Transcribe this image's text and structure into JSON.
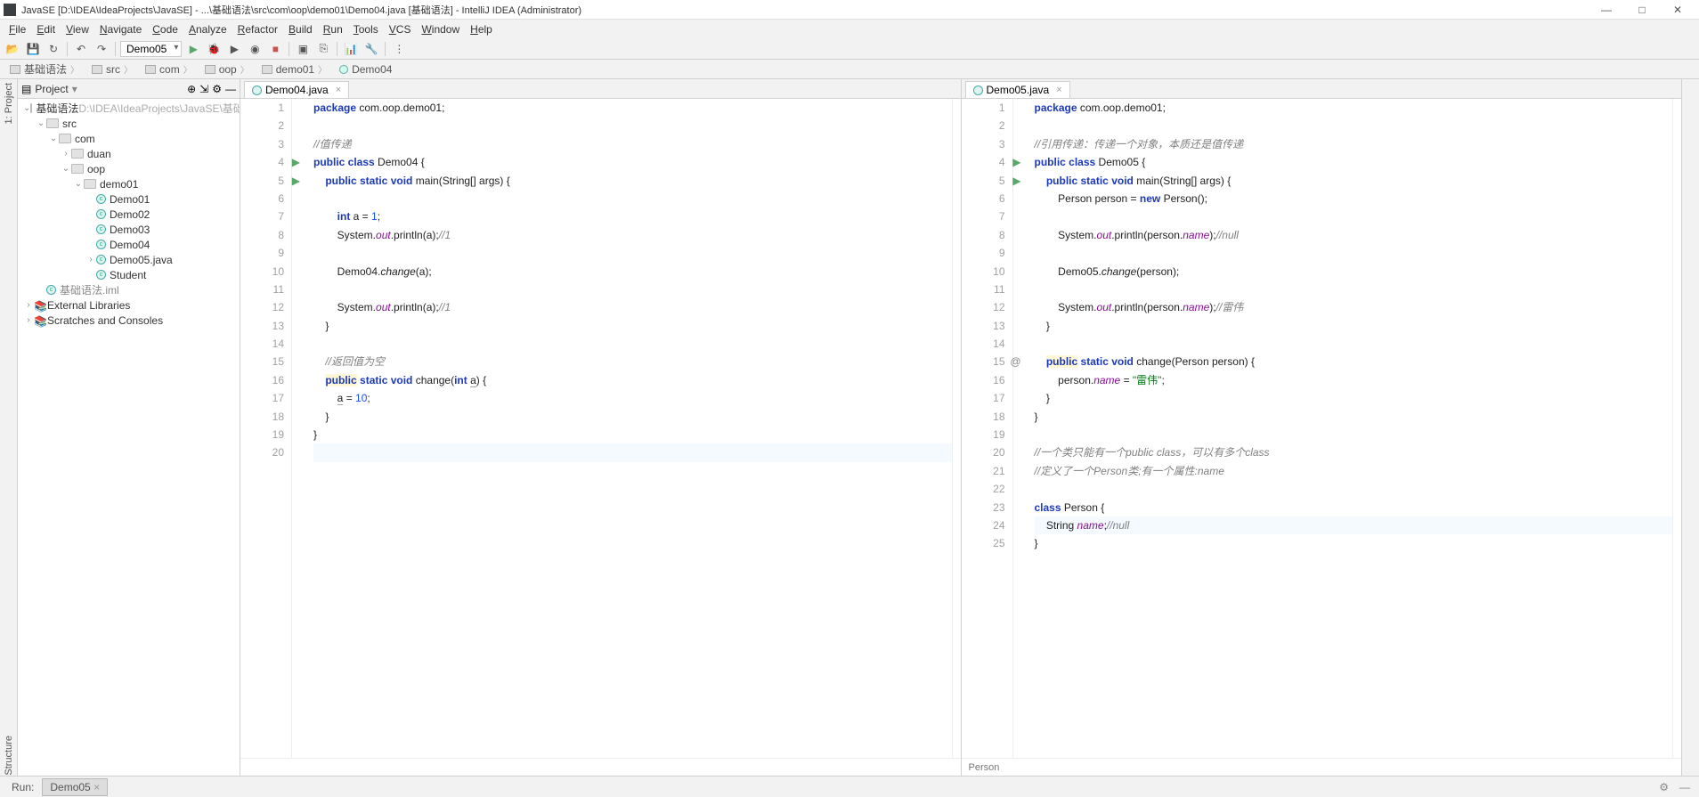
{
  "title": "JavaSE [D:\\IDEA\\IdeaProjects\\JavaSE] - ...\\基础语法\\src\\com\\oop\\demo01\\Demo04.java [基础语法] - IntelliJ IDEA (Administrator)",
  "menus": [
    "File",
    "Edit",
    "View",
    "Navigate",
    "Code",
    "Analyze",
    "Refactor",
    "Build",
    "Run",
    "Tools",
    "VCS",
    "Window",
    "Help"
  ],
  "runconfig": "Demo05",
  "breadcrumbs": [
    "基础语法",
    "src",
    "com",
    "oop",
    "demo01",
    "Demo04"
  ],
  "projectLabel": "Project",
  "tree": {
    "root": "基础语法",
    "rootPath": "D:\\IDEA\\IdeaProjects\\JavaSE\\基础语法",
    "src": "src",
    "com": "com",
    "duan": "duan",
    "oop": "oop",
    "demo01": "demo01",
    "files": [
      "Demo01",
      "Demo02",
      "Demo03",
      "Demo04",
      "Demo05.java",
      "Student"
    ],
    "iml": "基础语法.iml",
    "ext": "External Libraries",
    "scratches": "Scratches and Consoles"
  },
  "leftEditor": {
    "tab": "Demo04.java",
    "lines": 20,
    "code": [
      {
        "n": 1,
        "t": [
          {
            "c": "kw",
            "s": "package"
          },
          {
            "s": " com.oop.demo01;"
          }
        ]
      },
      {
        "n": 2,
        "t": []
      },
      {
        "n": 3,
        "t": [
          {
            "c": "comment",
            "s": "//值传递"
          }
        ]
      },
      {
        "n": 4,
        "run": true,
        "t": [
          {
            "c": "kw",
            "s": "public class"
          },
          {
            "s": " Demo04 {"
          }
        ]
      },
      {
        "n": 5,
        "run": true,
        "t": [
          {
            "s": "    "
          },
          {
            "c": "kw",
            "s": "public static void"
          },
          {
            "s": " main(String[] args) {"
          }
        ]
      },
      {
        "n": 6,
        "t": []
      },
      {
        "n": 7,
        "t": [
          {
            "s": "        "
          },
          {
            "c": "kw",
            "s": "int"
          },
          {
            "s": " a = "
          },
          {
            "c": "num",
            "s": "1"
          },
          {
            "s": ";"
          }
        ]
      },
      {
        "n": 8,
        "t": [
          {
            "s": "        System."
          },
          {
            "c": "field",
            "s": "out"
          },
          {
            "s": ".println(a);"
          },
          {
            "c": "comment",
            "s": "//1"
          }
        ]
      },
      {
        "n": 9,
        "t": []
      },
      {
        "n": 10,
        "t": [
          {
            "s": "        Demo04."
          },
          {
            "s": "change",
            "i": true
          },
          {
            "s": "(a);"
          }
        ]
      },
      {
        "n": 11,
        "t": []
      },
      {
        "n": 12,
        "t": [
          {
            "s": "        System."
          },
          {
            "c": "field",
            "s": "out"
          },
          {
            "s": ".println(a);"
          },
          {
            "c": "comment",
            "s": "//1"
          }
        ]
      },
      {
        "n": 13,
        "t": [
          {
            "s": "    }"
          }
        ]
      },
      {
        "n": 14,
        "t": []
      },
      {
        "n": 15,
        "t": [
          {
            "s": "    "
          },
          {
            "c": "comment",
            "s": "//返回值为空"
          }
        ]
      },
      {
        "n": 16,
        "t": [
          {
            "s": "    "
          },
          {
            "c": "kw hl-y",
            "s": "public"
          },
          {
            "s": " "
          },
          {
            "c": "kw",
            "s": "static void"
          },
          {
            "s": " change("
          },
          {
            "c": "kw",
            "s": "int"
          },
          {
            "s": " "
          },
          {
            "c": "underline",
            "s": "a"
          },
          {
            "s": ") {"
          }
        ]
      },
      {
        "n": 17,
        "t": [
          {
            "s": "        "
          },
          {
            "c": "underline",
            "s": "a"
          },
          {
            "s": " = "
          },
          {
            "c": "num",
            "s": "10"
          },
          {
            "s": ";"
          }
        ]
      },
      {
        "n": 18,
        "t": [
          {
            "s": "    }"
          }
        ]
      },
      {
        "n": 19,
        "t": [
          {
            "s": "}"
          }
        ]
      },
      {
        "n": 20,
        "caret": true,
        "t": []
      }
    ]
  },
  "rightEditor": {
    "tab": "Demo05.java",
    "lines": 25,
    "status": "Person",
    "code": [
      {
        "n": 1,
        "t": [
          {
            "c": "kw",
            "s": "package"
          },
          {
            "s": " com.oop.demo01;"
          }
        ]
      },
      {
        "n": 2,
        "t": []
      },
      {
        "n": 3,
        "t": [
          {
            "c": "comment",
            "s": "//引用传递：传递一个对象，本质还是值传递"
          }
        ]
      },
      {
        "n": 4,
        "run": true,
        "t": [
          {
            "c": "kw",
            "s": "public class"
          },
          {
            "s": " Demo05 {"
          }
        ]
      },
      {
        "n": 5,
        "run": true,
        "t": [
          {
            "s": "    "
          },
          {
            "c": "kw",
            "s": "public static void"
          },
          {
            "s": " main(String[] args) {"
          }
        ]
      },
      {
        "n": 6,
        "t": [
          {
            "s": "        Person person = "
          },
          {
            "c": "kw",
            "s": "new"
          },
          {
            "s": " Person();"
          }
        ]
      },
      {
        "n": 7,
        "t": []
      },
      {
        "n": 8,
        "t": [
          {
            "s": "        System."
          },
          {
            "c": "field",
            "s": "out"
          },
          {
            "s": ".println(person."
          },
          {
            "c": "field",
            "s": "name"
          },
          {
            "s": ");"
          },
          {
            "c": "comment",
            "s": "//null"
          }
        ]
      },
      {
        "n": 9,
        "t": []
      },
      {
        "n": 10,
        "t": [
          {
            "s": "        Demo05."
          },
          {
            "s": "change",
            "i": true
          },
          {
            "s": "(person);"
          }
        ]
      },
      {
        "n": 11,
        "t": []
      },
      {
        "n": 12,
        "t": [
          {
            "s": "        System."
          },
          {
            "c": "field",
            "s": "out"
          },
          {
            "s": ".println(person."
          },
          {
            "c": "field",
            "s": "name"
          },
          {
            "s": ");"
          },
          {
            "c": "comment",
            "s": "//雷伟"
          }
        ]
      },
      {
        "n": 13,
        "t": [
          {
            "s": "    }"
          }
        ]
      },
      {
        "n": 14,
        "t": []
      },
      {
        "n": 15,
        "mark": "@",
        "t": [
          {
            "s": "    "
          },
          {
            "c": "kw hl-y",
            "s": "public"
          },
          {
            "s": " "
          },
          {
            "c": "kw",
            "s": "static void"
          },
          {
            "s": " change(Person person) {"
          }
        ]
      },
      {
        "n": 16,
        "t": [
          {
            "s": "        person."
          },
          {
            "c": "field",
            "s": "name"
          },
          {
            "s": " = "
          },
          {
            "c": "str",
            "s": "\"雷伟\""
          },
          {
            "s": ";"
          }
        ]
      },
      {
        "n": 17,
        "t": [
          {
            "s": "    }"
          }
        ]
      },
      {
        "n": 18,
        "t": [
          {
            "s": "}"
          }
        ]
      },
      {
        "n": 19,
        "t": []
      },
      {
        "n": 20,
        "t": [
          {
            "c": "comment",
            "s": "//一个类只能有一个public class，可以有多个class"
          }
        ]
      },
      {
        "n": 21,
        "t": [
          {
            "c": "comment",
            "s": "//定义了一个Person类;有一个属性:name"
          }
        ]
      },
      {
        "n": 22,
        "t": []
      },
      {
        "n": 23,
        "t": [
          {
            "c": "kw",
            "s": "class"
          },
          {
            "s": " Person {"
          }
        ]
      },
      {
        "n": 24,
        "caret": true,
        "t": [
          {
            "s": "    String "
          },
          {
            "c": "field",
            "s": "name"
          },
          {
            "s": ";"
          },
          {
            "c": "comment",
            "s": "//null"
          }
        ]
      },
      {
        "n": 25,
        "t": [
          {
            "s": "}"
          }
        ]
      }
    ]
  },
  "bottom": {
    "run": "Run:",
    "tab": "Demo05"
  },
  "sideProject": "1: Project",
  "sideStructure": "Structure"
}
